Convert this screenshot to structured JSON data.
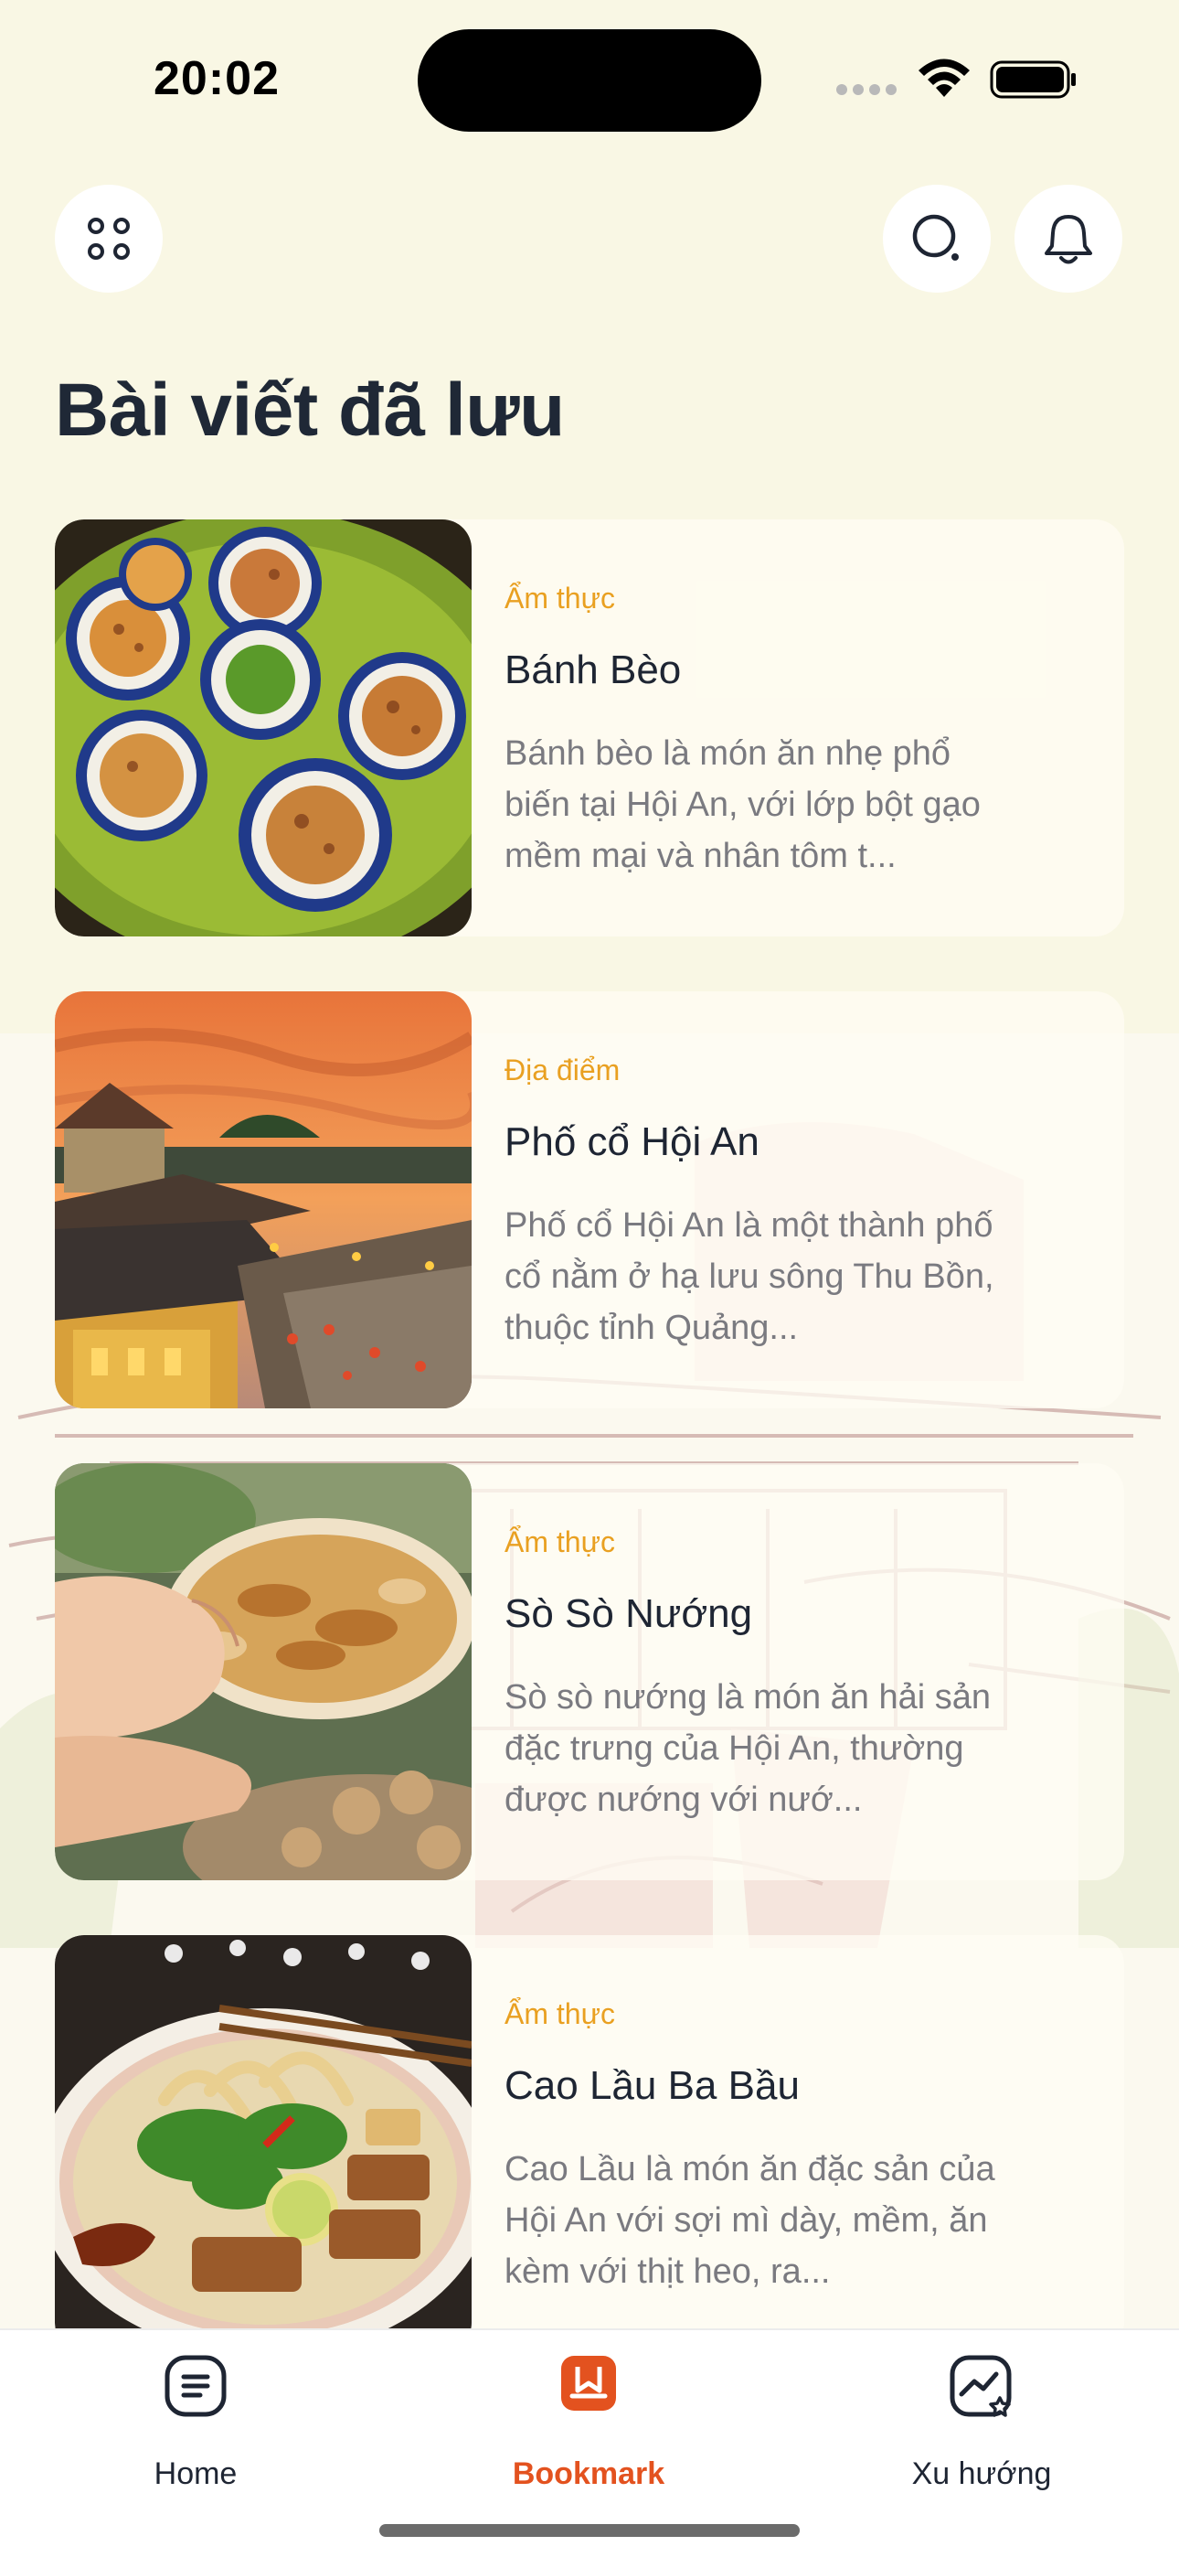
{
  "status_bar": {
    "time": "20:02"
  },
  "header": {
    "title": "Bài viết đã lưu",
    "menu_icon": "grid-dots-icon",
    "search_icon": "search-icon",
    "bell_icon": "bell-icon"
  },
  "articles": [
    {
      "category": "Ẩm thực",
      "title": "Bánh Bèo",
      "description": "Bánh bèo là món ăn nhẹ phổ biến tại Hội An, với lớp bột gạo mềm mại và nhân tôm t...",
      "image": "banh-beo-photo"
    },
    {
      "category": "Địa điểm",
      "title": "Phố cổ Hội An",
      "description": "Phố cổ Hội An là một thành phố cổ nằm ở hạ lưu sông Thu Bồn, thuộc tỉnh Quảng...",
      "image": "hoi-an-old-town-photo"
    },
    {
      "category": "Ẩm thực",
      "title": "Sò Sò Nướng",
      "description": "Sò sò nướng là món ăn hải sản đặc trưng của Hội An, thường được nướng với nướ...",
      "image": "so-so-nuong-photo"
    },
    {
      "category": "Ẩm thực",
      "title": "Cao Lầu Ba Bầu",
      "description": "Cao Lầu là món ăn đặc sản của Hội An với sợi mì dày, mềm, ăn kèm với thịt heo, ra...",
      "image": "cao-lau-photo"
    }
  ],
  "tab_bar": {
    "items": [
      {
        "label": "Home",
        "icon": "home-icon",
        "active": false
      },
      {
        "label": "Bookmark",
        "icon": "bookmark-icon",
        "active": true
      },
      {
        "label": "Xu hướng",
        "icon": "trending-icon",
        "active": false
      }
    ]
  },
  "colors": {
    "background": "#f9f7e4",
    "accent": "#e3521f",
    "category": "#e9a021",
    "title_text": "#1f2836",
    "body_text": "#7a7a80"
  }
}
